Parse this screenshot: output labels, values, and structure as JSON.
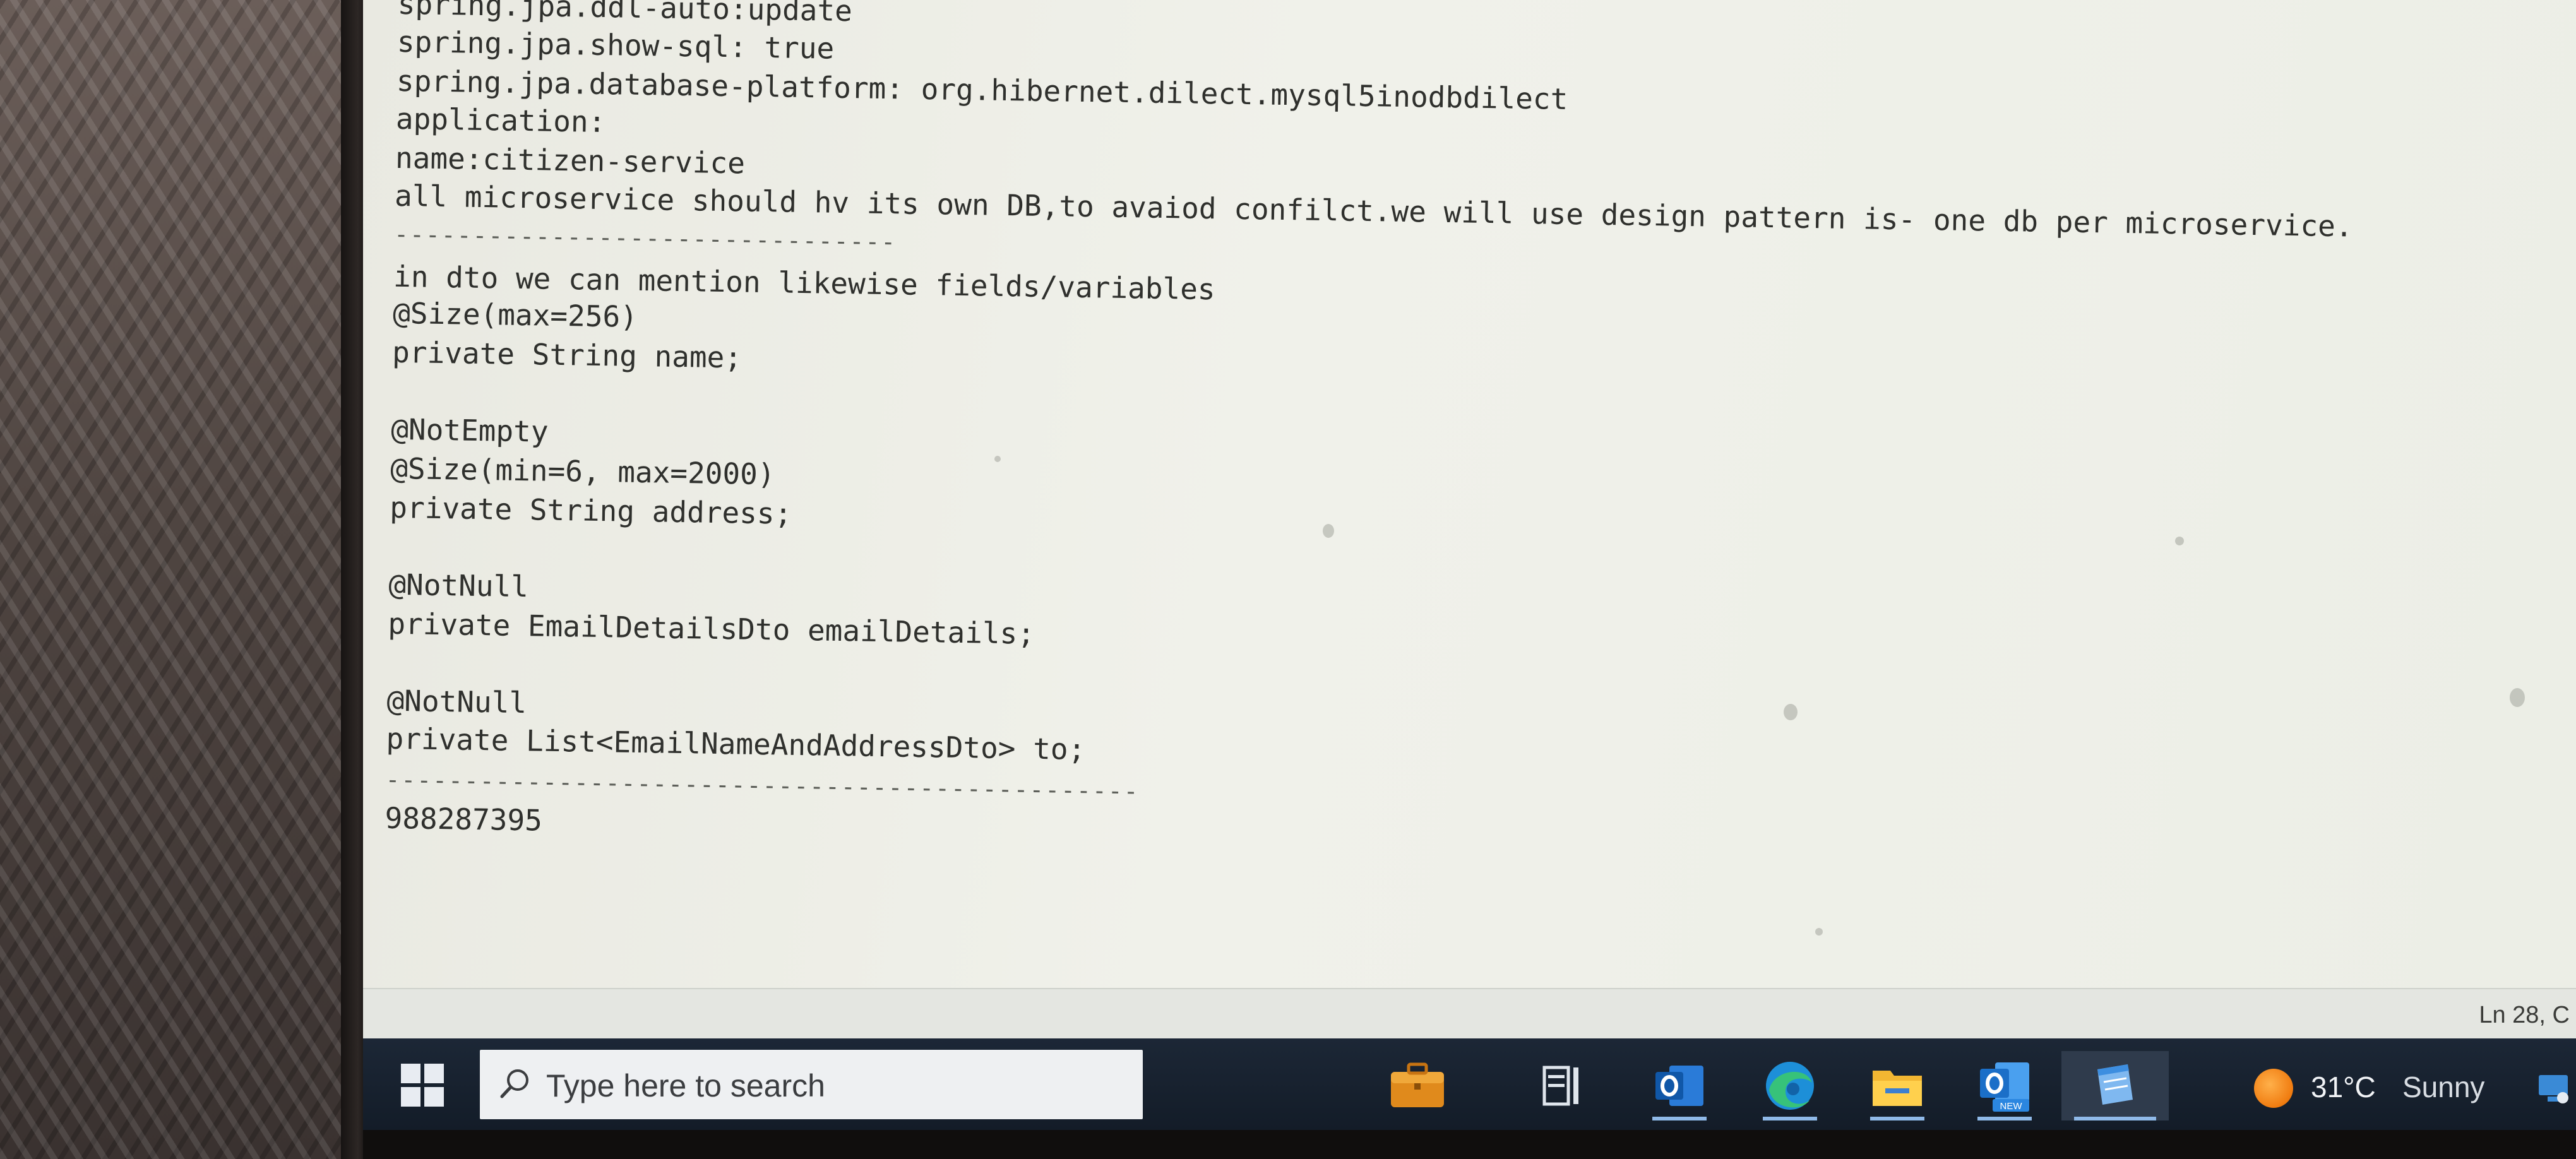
{
  "editor": {
    "lines": [
      "spring.jpa.ddl-auto:update",
      "spring.jpa.show-sql: true",
      "spring.jpa.database-platform: org.hibernet.dilect.mysql5inodbdilect",
      "application:",
      "name:citizen-service",
      "all microservice should hv its own DB,to avaiod confilct.we will use design pattern is- one db per microservice.",
      "--------------------------------",
      "in dto we can mention likewise fields/variables",
      "@Size(max=256)",
      "private String name;",
      "",
      "@NotEmpty",
      "@Size(min=6, max=2000)",
      "private String address;",
      "",
      "@NotNull",
      "private EmailDetailsDto emailDetails;",
      "",
      "@NotNull",
      "private List<EmailNameAndAddressDto> to;",
      "------------------------------------------------",
      "988287395"
    ]
  },
  "status_bar": {
    "position": "Ln 28, C"
  },
  "taskbar": {
    "start_icon": "windows-logo-icon",
    "search_placeholder": "Type here to search",
    "pinned": [
      {
        "name": "microsoft-store-icon",
        "active": false
      },
      {
        "name": "task-view-icon",
        "active": false
      },
      {
        "name": "outlook-icon",
        "active": true
      },
      {
        "name": "edge-icon",
        "active": true
      },
      {
        "name": "file-explorer-icon",
        "active": true
      },
      {
        "name": "outlook-new-icon",
        "active": true
      },
      {
        "name": "notepad-icon",
        "active": true
      }
    ],
    "weather": {
      "temperature": "31°C",
      "condition": "Sunny"
    }
  },
  "colors": {
    "editor_bg": "#eceee6",
    "editor_text": "#2f302d",
    "taskbar_bg": "#1a2431",
    "accent": "#8fb9e8"
  }
}
